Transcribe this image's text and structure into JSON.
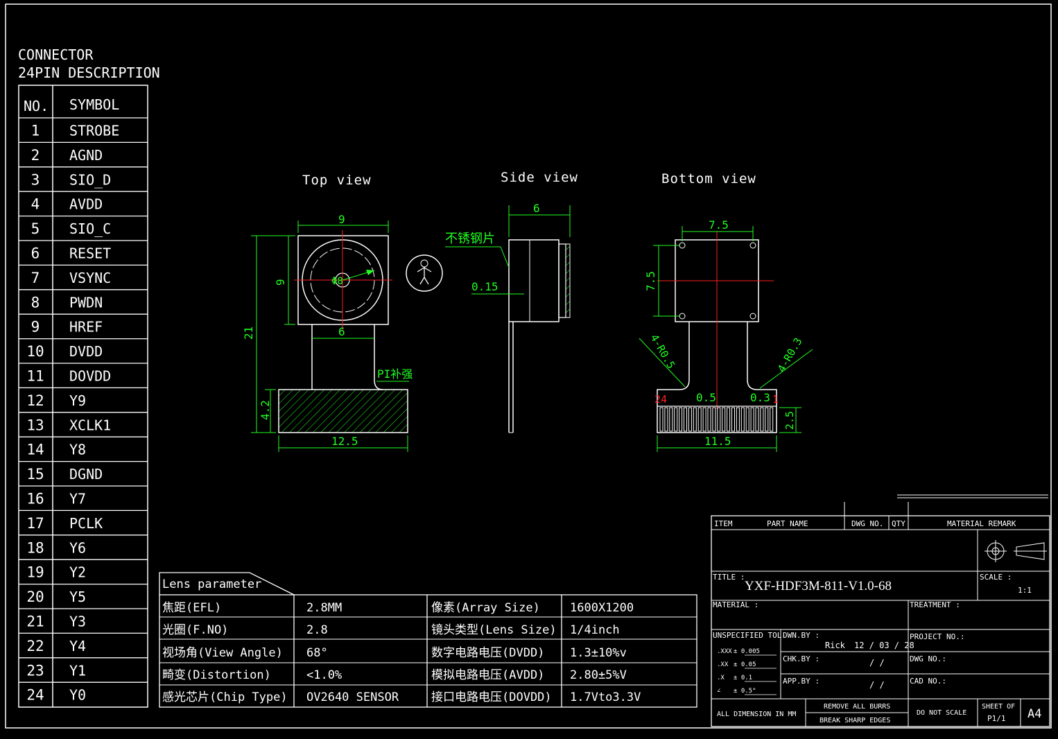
{
  "connector": {
    "title_line1": "CONNECTOR",
    "title_line2": "24PIN DESCRIPTION",
    "header_no": "NO.",
    "header_symbol": "SYMBOL",
    "pins": [
      {
        "no": "1",
        "symbol": "STROBE"
      },
      {
        "no": "2",
        "symbol": "AGND"
      },
      {
        "no": "3",
        "symbol": "SIO_D"
      },
      {
        "no": "4",
        "symbol": "AVDD"
      },
      {
        "no": "5",
        "symbol": "SIO_C"
      },
      {
        "no": "6",
        "symbol": "RESET"
      },
      {
        "no": "7",
        "symbol": "VSYNC"
      },
      {
        "no": "8",
        "symbol": "PWDN"
      },
      {
        "no": "9",
        "symbol": "HREF"
      },
      {
        "no": "10",
        "symbol": "DVDD"
      },
      {
        "no": "11",
        "symbol": "DOVDD"
      },
      {
        "no": "12",
        "symbol": "Y9"
      },
      {
        "no": "13",
        "symbol": "XCLK1"
      },
      {
        "no": "14",
        "symbol": "Y8"
      },
      {
        "no": "15",
        "symbol": "DGND"
      },
      {
        "no": "16",
        "symbol": "Y7"
      },
      {
        "no": "17",
        "symbol": "PCLK"
      },
      {
        "no": "18",
        "symbol": "Y6"
      },
      {
        "no": "19",
        "symbol": "Y2"
      },
      {
        "no": "20",
        "symbol": "Y5"
      },
      {
        "no": "21",
        "symbol": "Y3"
      },
      {
        "no": "22",
        "symbol": "Y4"
      },
      {
        "no": "23",
        "symbol": "Y1"
      },
      {
        "no": "24",
        "symbol": "Y0"
      }
    ]
  },
  "views": {
    "top": {
      "label": "Top  view",
      "dim_width": "9",
      "dim_height": "9",
      "dim_lens": "6",
      "dim_total": "21",
      "dim_stiffener_h": "4.2",
      "dim_stiffener_w": "12.5",
      "lens_mark": "Φ8",
      "pi_note": "PI补强"
    },
    "side": {
      "label": "Side  view",
      "dim_depth": "6",
      "dim_plate": "0.15",
      "steel_note": "不锈钢片"
    },
    "bottom": {
      "label": "Bottom  view",
      "dim_hole_w": "7.5",
      "dim_hole_h": "7.5",
      "note_left": "4-R0.5",
      "note_right": "4-R0.3",
      "pin_first": "24",
      "pin_last": "1",
      "dim_pitch": "0.5",
      "dim_gap": "0.3",
      "dim_conn_w": "11.5",
      "dim_conn_h": "2.5"
    }
  },
  "lens": {
    "title": "Lens parameter",
    "rows": [
      {
        "label": "焦距(EFL)",
        "value": "2.8MM",
        "label2": "像素(Array Size)",
        "value2": "1600X1200"
      },
      {
        "label": "光圈(F.NO)",
        "value": "2.8",
        "label2": "镜头类型(Lens Size)",
        "value2": "1/4inch"
      },
      {
        "label": "视场角(View Angle)",
        "value": "68°",
        "label2": "数字电路电压(DVDD)",
        "value2": "1.3±10%v"
      },
      {
        "label": "畸变(Distortion)",
        "value": "<1.0%",
        "label2": "模拟电路电压(AVDD)",
        "value2": "2.80±5%V"
      },
      {
        "label": "感光芯片(Chip Type)",
        "value": "OV2640 SENSOR",
        "label2": "接口电路电压(DOVDD)",
        "value2": "1.7Vto3.3V"
      }
    ]
  },
  "titleblock": {
    "hdr_item": "ITEM",
    "hdr_part": "PART NAME",
    "hdr_dwg": "DWG NO.",
    "hdr_qty": "QTY",
    "hdr_material": "MATERIAL REMARK",
    "title_label": "TITLE :",
    "title_value": "YXF-HDF3M-811-V1.0-68",
    "scale_label": "SCALE :",
    "scale_value": "1:1",
    "material_label": "MATERIAL :",
    "treatment_label": "TREATMENT :",
    "tol_label": "UNSPECIFIED TOL.",
    "tol_rows": [
      {
        "k": ".XXX",
        "v": "±   0.005"
      },
      {
        "k": ".XX",
        "v": "±   0.05"
      },
      {
        "k": ".X",
        "v": "±   0.1"
      },
      {
        "k": "∠",
        "v": "±   0.5°"
      }
    ],
    "dwn_label": "DWN.BY :",
    "dwn_name": "Rick",
    "dwn_date": "12 / 03 / 28",
    "chk_label": "CHK.BY :",
    "chk_date": "/    /",
    "app_label": "APP.BY :",
    "app_date": "/    /",
    "project_label": "PROJECT NO.:",
    "dwgno_label": "DWG NO.:",
    "cadno_label": "CAD NO.:",
    "all_dim": "ALL DIMENSION IN MM",
    "remove_burrs": "REMOVE ALL BURRS",
    "break_edges": "BREAK SHARP EDGES",
    "do_not_scale": "DO NOT SCALE",
    "sheet_of": "SHEET OF",
    "sheet_value": "P1/1",
    "size": "A4"
  }
}
